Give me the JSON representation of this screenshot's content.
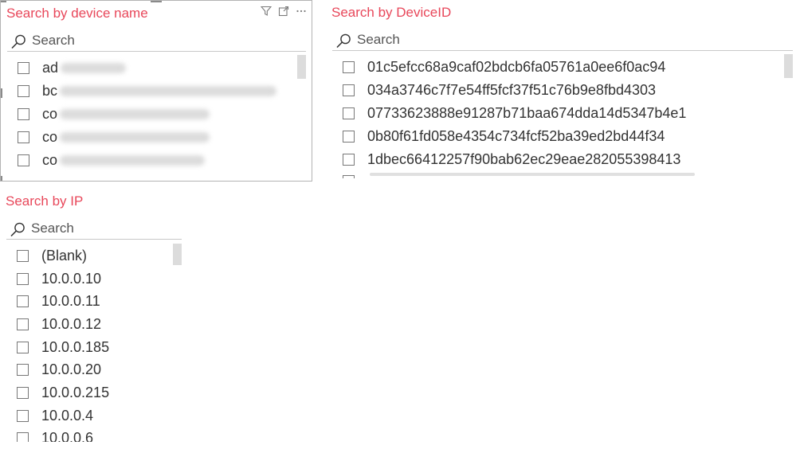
{
  "device_slicer": {
    "title": "Search by device name",
    "search_placeholder": "Search",
    "items": [
      {
        "label": "ad"
      },
      {
        "label": "bc"
      },
      {
        "label": "co"
      },
      {
        "label": "co"
      },
      {
        "label": "co"
      }
    ],
    "header_icons": [
      "filter-icon",
      "focus-mode-icon",
      "more-options-icon"
    ]
  },
  "deviceid_slicer": {
    "title": "Search by DeviceID",
    "search_placeholder": "Search",
    "items": [
      {
        "label": "01c5efcc68a9caf02bdcb6fa05761a0ee6f0ac94"
      },
      {
        "label": "034a3746c7f7e54ff5fcf37f51c76b9e8fbd4303"
      },
      {
        "label": "07733623888e91287b71baa674dda14d5347b4e1"
      },
      {
        "label": "0b80f61fd058e4354c734fcf52ba39ed2bd44f34"
      },
      {
        "label": "1dbec66412257f90bab62ec29eae282055398413"
      }
    ]
  },
  "ip_slicer": {
    "title": "Search by IP",
    "search_placeholder": "Search",
    "items": [
      {
        "label": "(Blank)"
      },
      {
        "label": "10.0.0.10"
      },
      {
        "label": "10.0.0.11"
      },
      {
        "label": "10.0.0.12"
      },
      {
        "label": "10.0.0.185"
      },
      {
        "label": "10.0.0.20"
      },
      {
        "label": "10.0.0.215"
      },
      {
        "label": "10.0.0.4"
      },
      {
        "label": "10.0.0.6"
      }
    ]
  },
  "colors": {
    "title": "#e8475a",
    "text": "#333333",
    "scrollbar": "#dcdcdc",
    "border": "#b3b3b3"
  }
}
